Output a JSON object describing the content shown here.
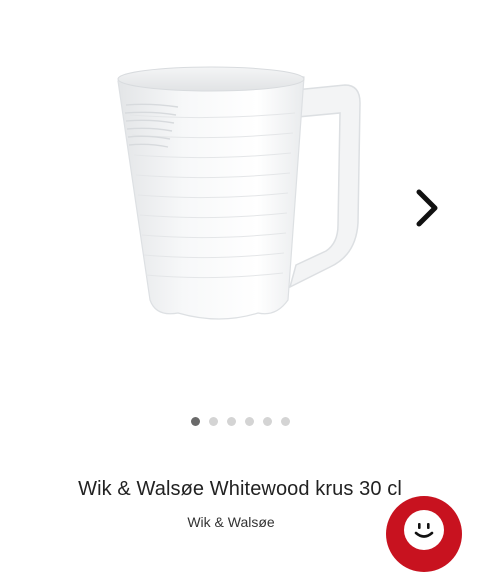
{
  "gallery": {
    "image_icon": "white-mug-image",
    "next_icon": "chevron-right-icon",
    "slide_count": 6,
    "active_slide": 1
  },
  "product": {
    "title": "Wik & Walsøe Whitewood krus 30 cl",
    "brand": "Wik & Walsøe"
  },
  "chat": {
    "icon": "smiley-chat-icon",
    "color": "#c8121f"
  }
}
